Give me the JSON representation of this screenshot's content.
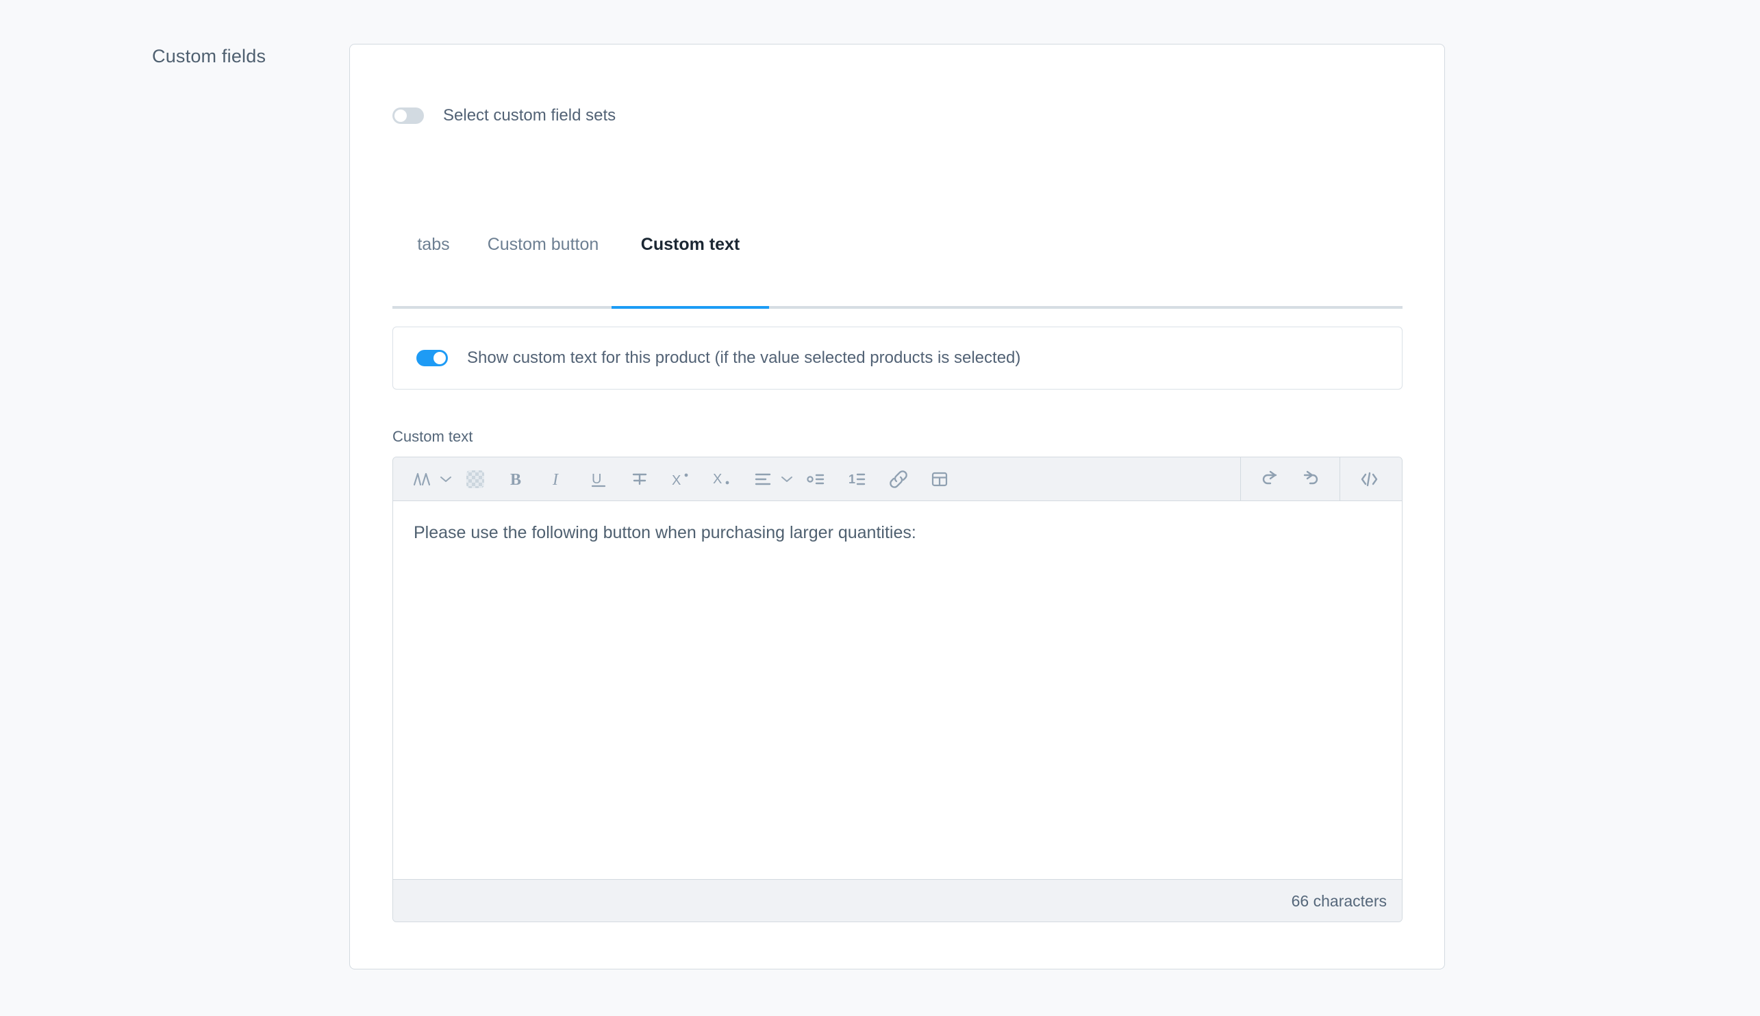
{
  "section": {
    "label": "Custom fields"
  },
  "fieldset_toggle": {
    "label": "Select custom field sets",
    "state": "off"
  },
  "tabs": {
    "items": [
      {
        "label": "tabs",
        "active": false
      },
      {
        "label": "Custom button",
        "active": false
      },
      {
        "label": "Custom text",
        "active": true
      }
    ],
    "active_color": "#1b9cf5"
  },
  "switch_panel": {
    "label": "Show custom text for this product (if the value selected products is selected)",
    "state": "on",
    "on_color": "#1e9bf5"
  },
  "editor": {
    "label": "Custom text",
    "content": "Please use the following button when purchasing larger quantities:",
    "character_count": "66 characters",
    "toolbar": {
      "left": [
        {
          "icon": "font-format-icon",
          "has_chevron": true
        },
        {
          "icon": "text-color-icon",
          "has_chevron": false
        },
        {
          "icon": "bold-icon",
          "has_chevron": false
        },
        {
          "icon": "italic-icon",
          "has_chevron": false
        },
        {
          "icon": "underline-icon",
          "has_chevron": false
        },
        {
          "icon": "strikethrough-icon",
          "has_chevron": false
        },
        {
          "icon": "superscript-icon",
          "has_chevron": false
        },
        {
          "icon": "subscript-icon",
          "has_chevron": false
        },
        {
          "icon": "align-icon",
          "has_chevron": true
        },
        {
          "icon": "bullet-list-icon",
          "has_chevron": false
        },
        {
          "icon": "numbered-list-icon",
          "has_chevron": false
        },
        {
          "icon": "link-icon",
          "has_chevron": false
        },
        {
          "icon": "table-icon",
          "has_chevron": false
        }
      ],
      "right": [
        {
          "icon": "undo-icon"
        },
        {
          "icon": "redo-icon"
        },
        {
          "icon": "source-code-icon"
        }
      ]
    }
  }
}
